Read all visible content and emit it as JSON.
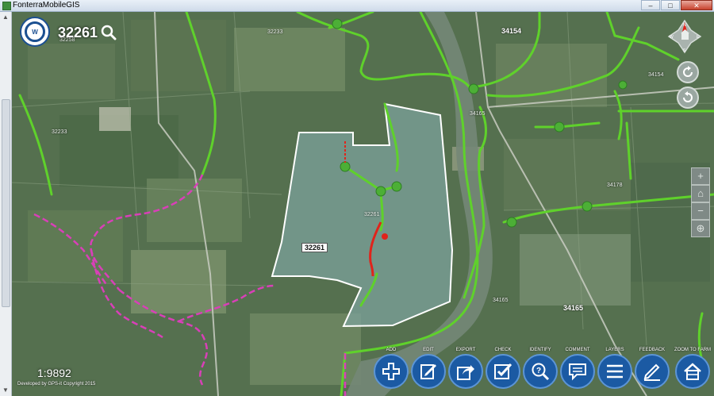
{
  "window": {
    "title": "FonterraMobileGIS",
    "minimize": "–",
    "maximize": "□",
    "close": "✕"
  },
  "header": {
    "logo_text": "W",
    "farm_id": "32261"
  },
  "map": {
    "farm_tag": "32261",
    "labels": {
      "l32233a": "32233",
      "l32258": "32258",
      "l32233b": "32233",
      "l34154a": "34154",
      "l34154b": "34154",
      "l34165a": "34165",
      "l32261": "32261",
      "l34178": "34178",
      "l34165b": "34165",
      "l34165c": "34165"
    },
    "colors": {
      "raceway": "#5fd12b",
      "selected_raceway": "#e0241b",
      "neighbour_boundary": "#d93fb8",
      "farm_boundary": "#ffffff"
    }
  },
  "scale": "1:9892",
  "copyright": "Developed by GPS-it Copyright 2015",
  "nav_icons": [
    "compass-icon",
    "rotate-clockwise-icon",
    "rotate-counterclockwise-icon"
  ],
  "toolbar": [
    {
      "label": "ADD",
      "icon": "plus-icon"
    },
    {
      "label": "EDIT",
      "icon": "edit-icon"
    },
    {
      "label": "EXPORT",
      "icon": "export-icon"
    },
    {
      "label": "CHECK",
      "icon": "check-icon"
    },
    {
      "label": "IDENTIFY",
      "icon": "identify-icon"
    },
    {
      "label": "COMMENT",
      "icon": "comment-icon"
    },
    {
      "label": "LAYERS",
      "icon": "layers-icon"
    },
    {
      "label": "FEEDBACK",
      "icon": "feedback-icon"
    },
    {
      "label": "ZOOM TO FARM",
      "icon": "home-icon"
    }
  ]
}
